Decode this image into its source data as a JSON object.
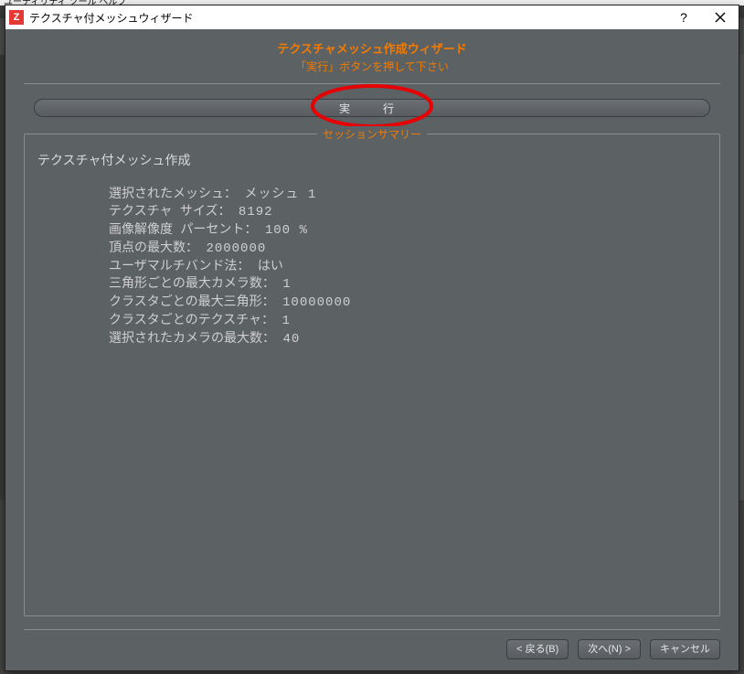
{
  "backdrop": {
    "menu_hint": "ユーティリティ ツール ヘルプ"
  },
  "dialog": {
    "title": "テクスチャ付メッシュウィザード",
    "header": "テクスチャメッシュ作成ウィザード",
    "subheader": "「実行」ボタンを押して下さい",
    "run_label": "実　行",
    "session_legend": "セッションサマリー",
    "summary_title": "テクスチャ付メッシュ作成",
    "summary": {
      "selected_mesh_label": "選択されたメッシュ：",
      "selected_mesh_value": "メッシュ 1",
      "texture_size_label": "テクスチャ サイズ：",
      "texture_size_value": "8192",
      "image_res_label": "画像解像度 パーセント：",
      "image_res_value": "100 %",
      "max_vertices_label": "頂点の最大数：",
      "max_vertices_value": "2000000",
      "multiband_label": "ユーザマルチバンド法：",
      "multiband_value": "はい",
      "max_cam_tri_label": "三角形ごとの最大カメラ数：",
      "max_cam_tri_value": "1",
      "max_tri_cluster_label": "クラスタごとの最大三角形：",
      "max_tri_cluster_value": "10000000",
      "tex_per_cluster_label": "クラスタごとのテクスチャ：",
      "tex_per_cluster_value": "1",
      "max_selected_cam_label": "選択されたカメラの最大数：",
      "max_selected_cam_value": "40"
    },
    "buttons": {
      "back": "< 戻る(B)",
      "next": "次へ(N) >",
      "cancel": "キャンセル"
    }
  }
}
